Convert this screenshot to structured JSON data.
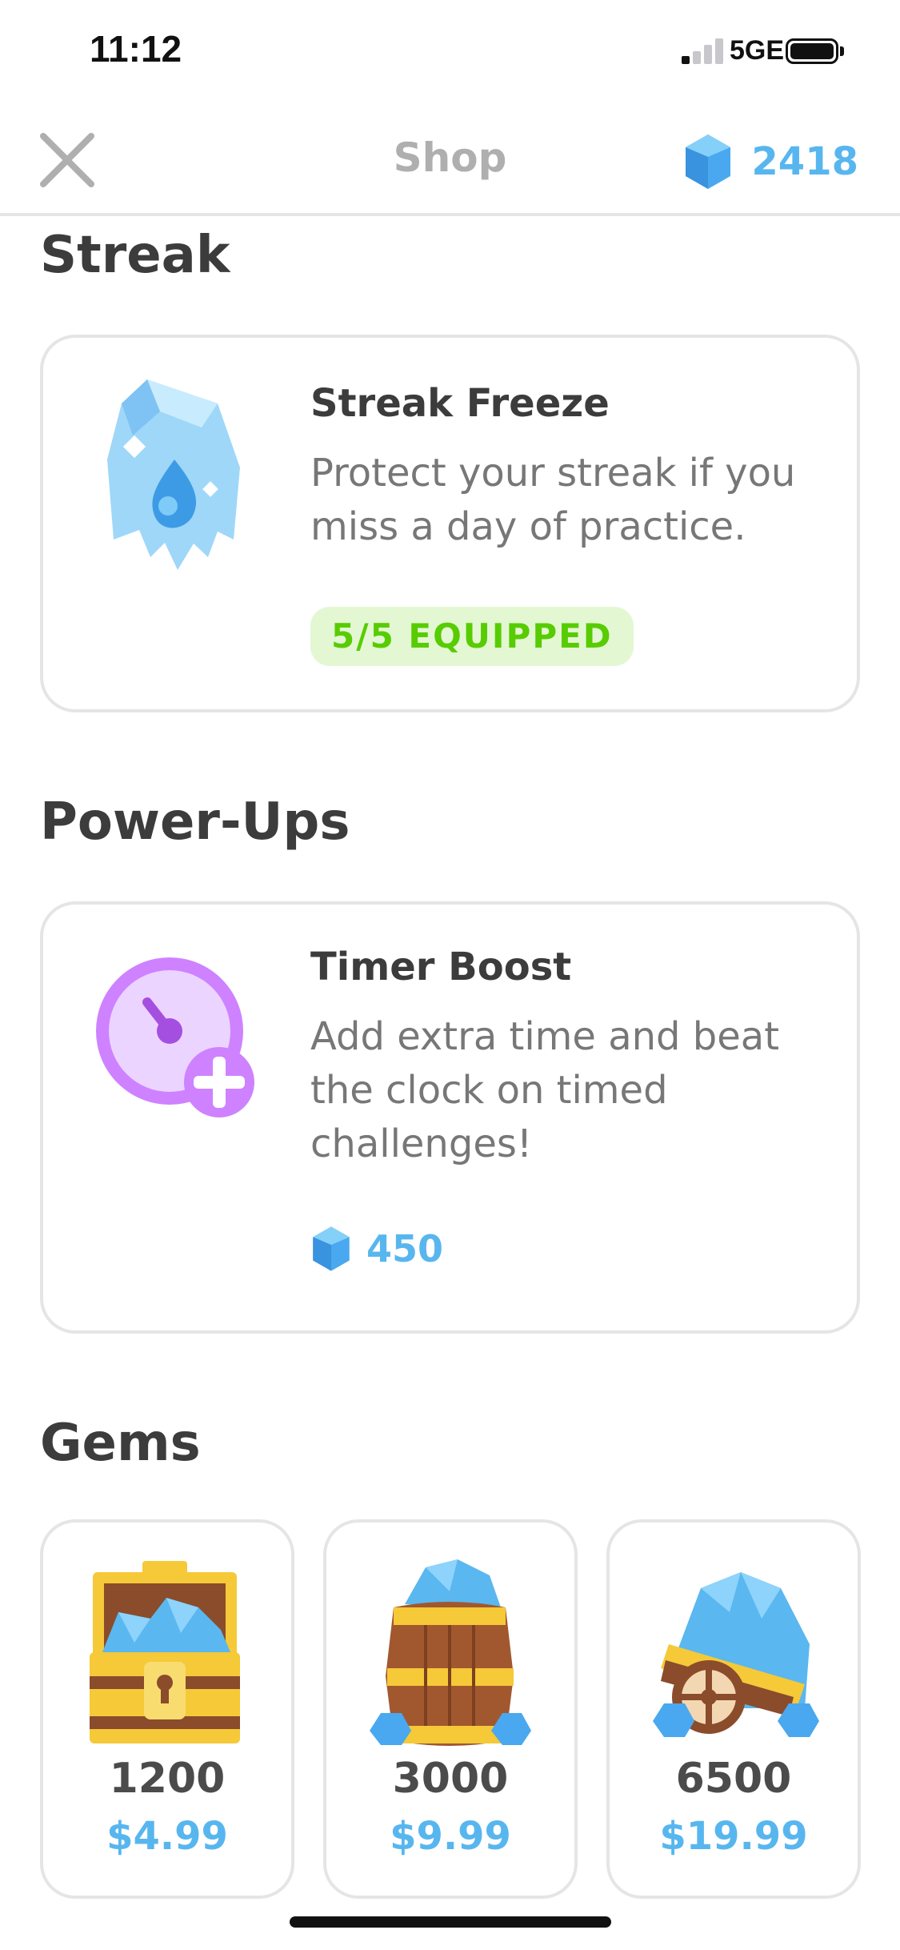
{
  "status_bar": {
    "time": "11:12",
    "network": "5GE"
  },
  "header": {
    "title": "Shop",
    "gem_balance": "2418",
    "close_icon": "close-icon",
    "gem_icon": "gem-icon"
  },
  "sections": {
    "streak": {
      "title": "Streak",
      "item": {
        "title": "Streak Freeze",
        "description": "Protect your streak if you miss a day of practice.",
        "badge": "5/5 EQUIPPED",
        "icon": "ice-crystal-icon"
      }
    },
    "powerups": {
      "title": "Power-Ups",
      "item": {
        "title": "Timer Boost",
        "description": "Add extra time and beat the clock on timed challenges!",
        "price": "450",
        "icon": "timer-boost-icon"
      }
    },
    "gems": {
      "title": "Gems",
      "packs": [
        {
          "amount": "1200",
          "price": "$4.99",
          "icon": "treasure-chest-icon"
        },
        {
          "amount": "3000",
          "price": "$9.99",
          "icon": "gem-barrel-icon"
        },
        {
          "amount": "6500",
          "price": "$19.99",
          "icon": "gem-cart-icon"
        }
      ]
    }
  },
  "colors": {
    "accent_blue": "#58b6ef",
    "equipped_green": "#58cc02",
    "equipped_bg": "#e4f7d3",
    "border": "#e5e5e5"
  }
}
